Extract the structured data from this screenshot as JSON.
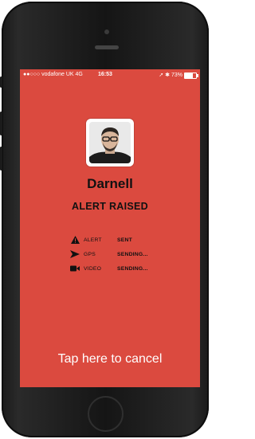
{
  "status_bar": {
    "carrier": "●●○○○ vodafone UK  4G",
    "time": "16:53",
    "right": "➚ ✱ 73%",
    "battery_percent": 73
  },
  "profile": {
    "name": "Darnell",
    "avatar_icon": "user-photo"
  },
  "alert_title": "ALERT RAISED",
  "status_rows": [
    {
      "icon": "warning-icon",
      "label": "ALERT",
      "value": "SENT"
    },
    {
      "icon": "gps-arrow-icon",
      "label": "GPS",
      "value": "SENDING..."
    },
    {
      "icon": "video-camera-icon",
      "label": "VIDEO",
      "value": "SENDING..."
    }
  ],
  "cancel_label": "Tap here to cancel",
  "colors": {
    "screen_bg": "#db4a3f",
    "text_dark": "#111111",
    "text_light": "#ffffff"
  }
}
